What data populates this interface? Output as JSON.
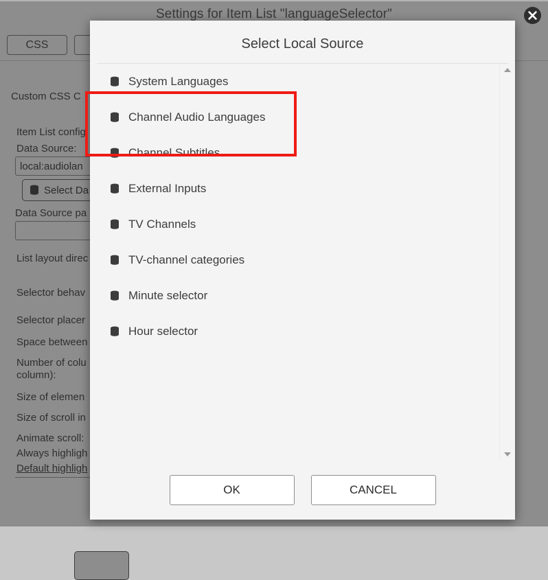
{
  "window": {
    "title": "Settings for Item List \"languageSelector\"",
    "close_icon": "close-circle-icon",
    "toolbar": {
      "css_label": "CSS",
      "second_label": ""
    }
  },
  "form": {
    "custom_css_label": "Custom CSS C",
    "item_list_config_label": "Item List config",
    "data_source_label": "Data Source:",
    "data_source_value": "local:audiolan",
    "select_data_source_button": "Select Da",
    "select_data_source_icon": "database-icon",
    "data_source_param_label": "Data Source pa",
    "data_source_param_value": "",
    "list_layout_label": "List layout direc",
    "selector_behavior_label": "Selector behav",
    "selector_placement_label": "Selector placer",
    "space_between_label": "Space between",
    "number_of_columns_label": "Number of colu",
    "number_of_columns_label2": "column):",
    "size_of_element_label": "Size of elemen",
    "size_of_scroll_label": "Size of scroll in",
    "animate_scroll_label": "Animate scroll:",
    "always_highlight_label": "Always highligh",
    "default_highlight_label": "Default highligh"
  },
  "dialog": {
    "title": "Select Local Source",
    "item_icon": "database-icon",
    "items": [
      {
        "label": "System Languages"
      },
      {
        "label": "Channel Audio Languages"
      },
      {
        "label": "Channel Subtitles"
      },
      {
        "label": "External Inputs"
      },
      {
        "label": "TV Channels"
      },
      {
        "label": "TV-channel categories"
      },
      {
        "label": "Minute selector"
      },
      {
        "label": "Hour selector"
      }
    ],
    "scrollbar": {
      "up_icon": "scroll-up-arrow-icon",
      "down_icon": "scroll-down-arrow-icon"
    },
    "ok_label": "OK",
    "cancel_label": "CANCEL"
  },
  "annotation": {
    "highlight_color": "#ee1b16"
  }
}
